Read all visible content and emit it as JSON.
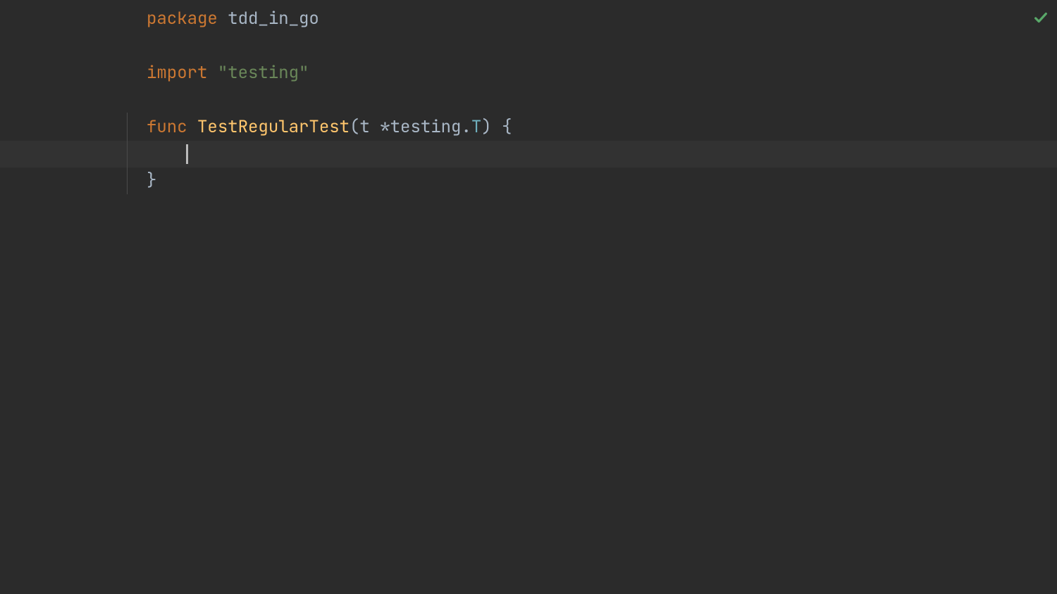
{
  "editor": {
    "lines": [
      {
        "tokens": [
          {
            "text": "package",
            "class": "keyword"
          },
          {
            "text": " ",
            "class": "punct"
          },
          {
            "text": "tdd_in_go",
            "class": "identifier"
          }
        ]
      },
      {
        "tokens": []
      },
      {
        "tokens": [
          {
            "text": "import",
            "class": "keyword"
          },
          {
            "text": " ",
            "class": "punct"
          },
          {
            "text": "\"testing\"",
            "class": "string"
          }
        ]
      },
      {
        "tokens": []
      },
      {
        "tokens": [
          {
            "text": "func",
            "class": "keyword"
          },
          {
            "text": " ",
            "class": "punct"
          },
          {
            "text": "TestRegularTest",
            "class": "func-name"
          },
          {
            "text": "(",
            "class": "punct"
          },
          {
            "text": "t ",
            "class": "identifier"
          },
          {
            "text": "*",
            "class": "punct"
          },
          {
            "text": "testing",
            "class": "identifier"
          },
          {
            "text": ".",
            "class": "punct"
          },
          {
            "text": "T",
            "class": "type"
          },
          {
            "text": ")",
            "class": "punct"
          },
          {
            "text": " {",
            "class": "punct"
          }
        ]
      },
      {
        "highlighted": true,
        "cursor": true,
        "tokens": []
      },
      {
        "tokens": [
          {
            "text": "}",
            "class": "punct"
          }
        ]
      }
    ]
  },
  "status": {
    "icon": "checkmark"
  }
}
